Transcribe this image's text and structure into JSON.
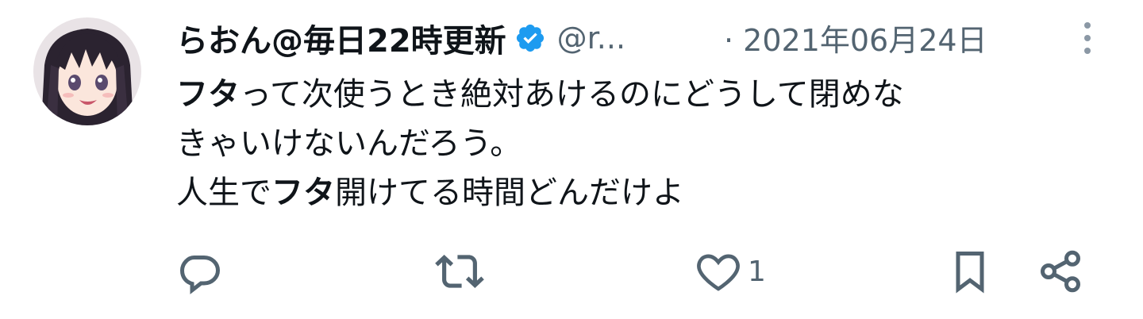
{
  "tweet": {
    "display_name": "らおん@毎日22時更新",
    "handle": "@r...",
    "date": "· 2021年06月24日",
    "body": {
      "line1": {
        "bold": "フタ",
        "rest": "って次使うとき絶対あけるのにどうして閉めな"
      },
      "line2": "きゃいけないんだろう。",
      "line3": {
        "before": "人生で",
        "bold": "フタ",
        "after": "開けてる時間どんだけよ"
      }
    },
    "actions": {
      "like_count": "1"
    }
  },
  "colors": {
    "verified": "#1d9bf0",
    "secondary_text": "#536471",
    "primary_text": "#0f1419"
  },
  "icons": [
    "verified-badge-icon",
    "more-vertical-icon",
    "reply-icon",
    "retweet-icon",
    "like-icon",
    "bookmark-icon",
    "share-icon"
  ]
}
